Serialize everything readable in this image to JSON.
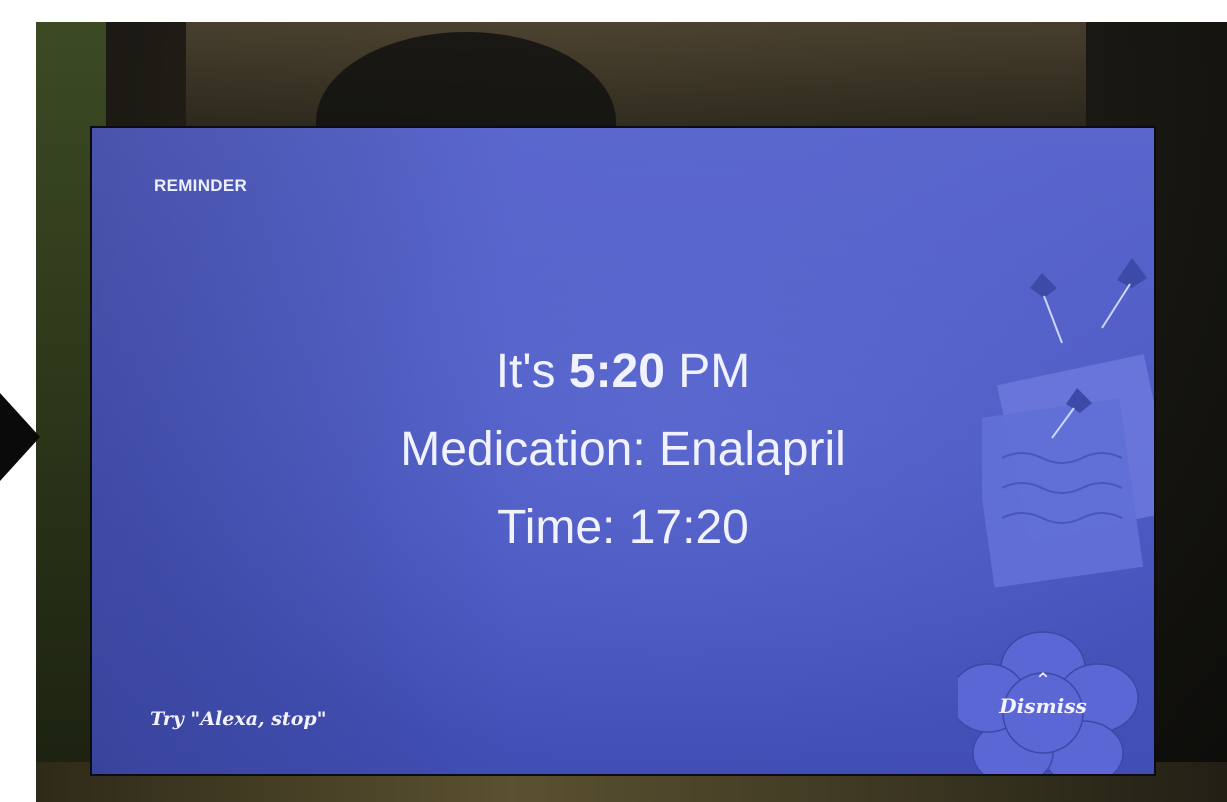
{
  "reminder": {
    "header": "REMINDER",
    "time_prefix": "It's ",
    "time_value": "5:20",
    "time_suffix": " PM",
    "medication_line": "Medication: Enalapril",
    "time_line": "Time: 17:20"
  },
  "footer": {
    "hint": "Try \"Alexa, stop\"",
    "dismiss_label": "Dismiss"
  },
  "icons": {
    "dismiss_chevron": "chevron-up-icon",
    "decor": "pinned-notes-illustration"
  },
  "colors": {
    "screen_bg": "#4b58c2",
    "text": "#f1f2ff",
    "flower": "#5863d4"
  }
}
